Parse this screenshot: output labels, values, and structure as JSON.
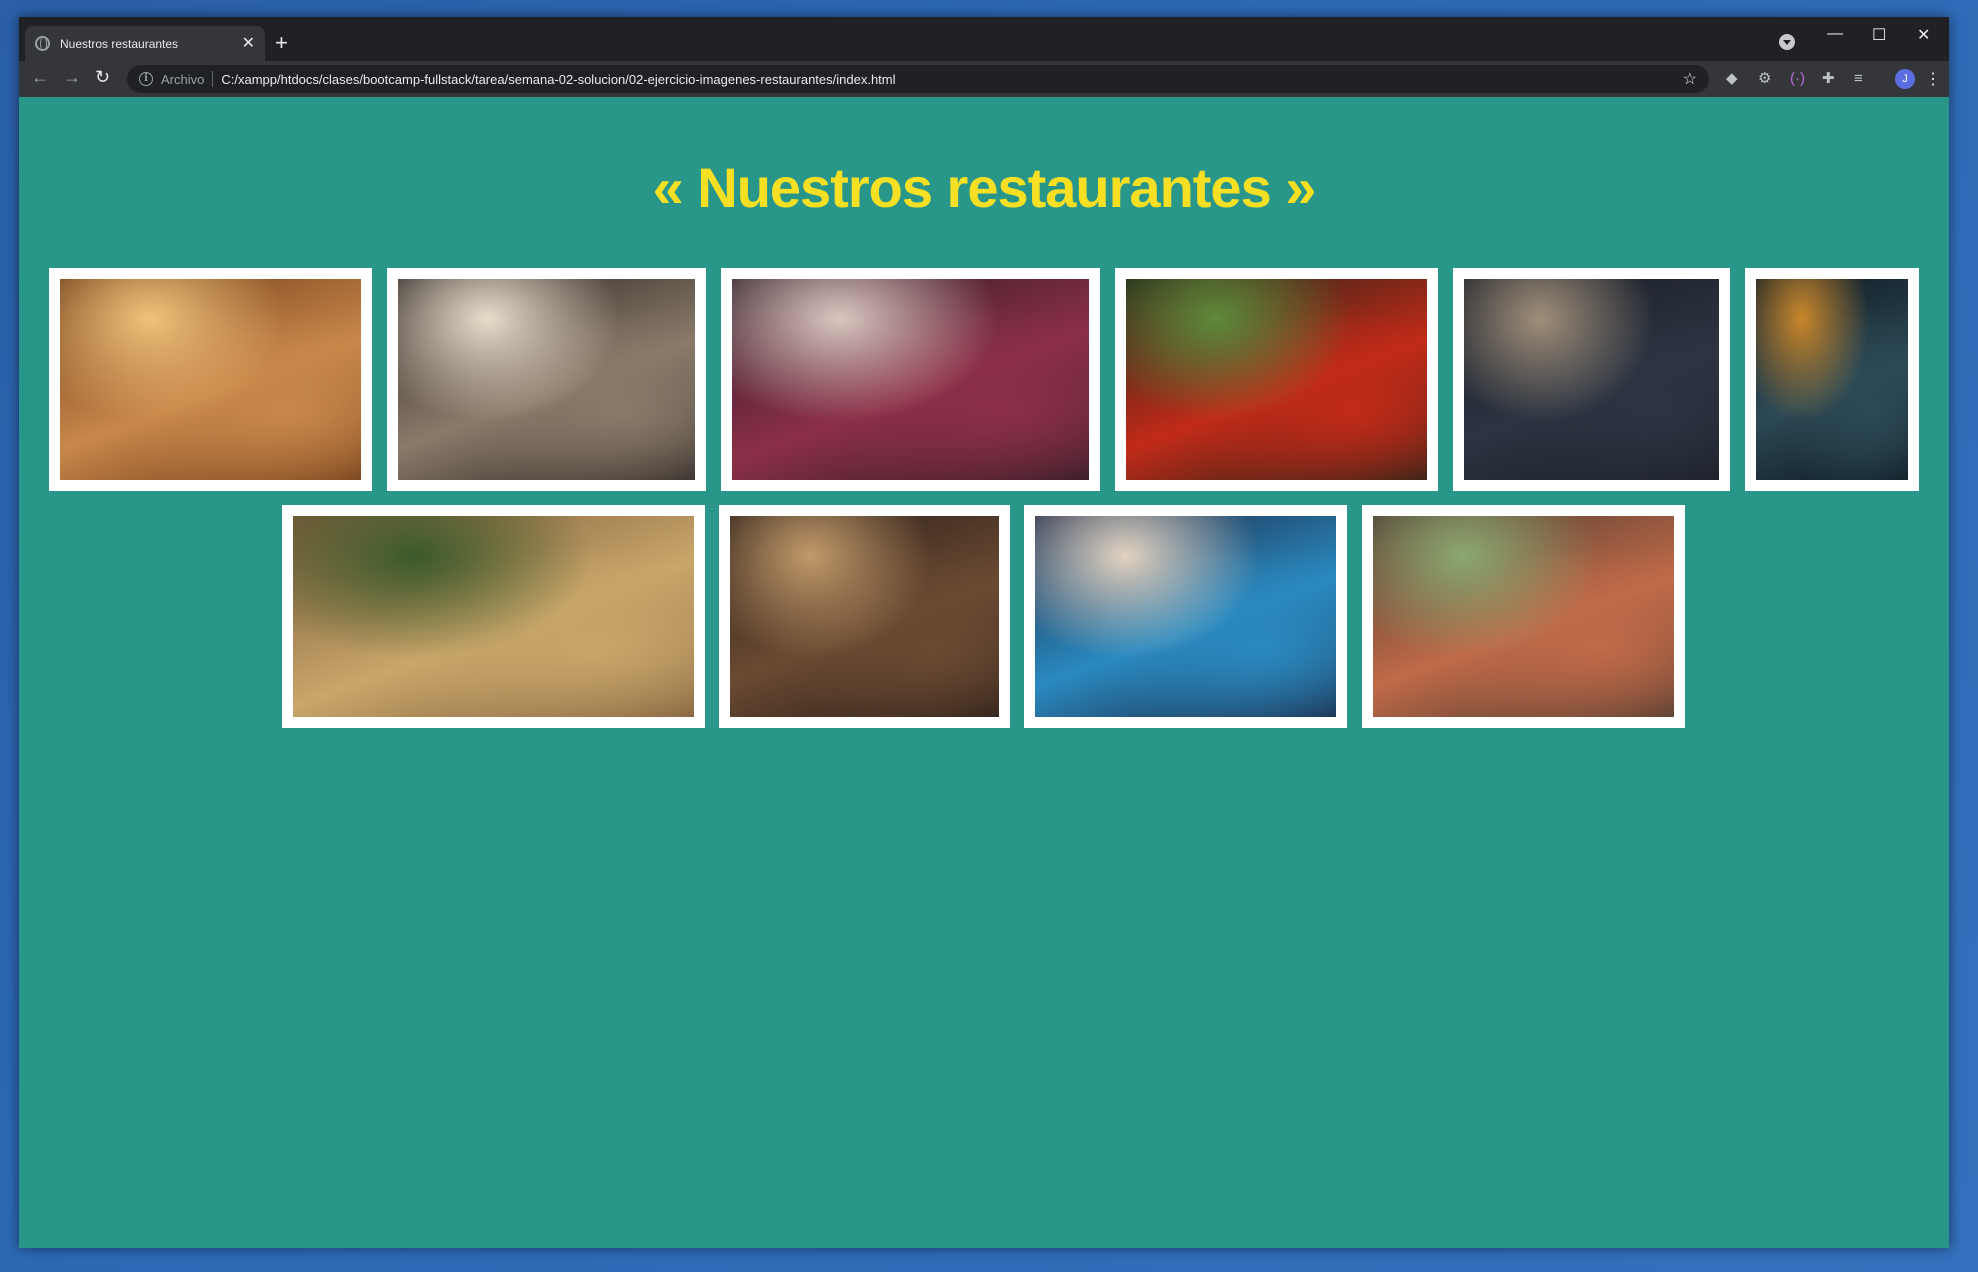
{
  "browser": {
    "tab_title": "Nuestros restaurantes",
    "tab_close": "✕",
    "new_tab": "+",
    "secure_label": "Archivo",
    "url": "C:/xampp/htdocs/clases/bootcamp-fullstack/tarea/semana-02-solucion/02-ejercicio-imagenes-restaurantes/index.html",
    "avatar_letter": "J",
    "icons": {
      "back": "←",
      "forward": "→",
      "reload": "↻",
      "star": "☆",
      "menu": "⋮",
      "minimize": "—",
      "maximize": "☐",
      "close": "✕"
    }
  },
  "page": {
    "title": "« Nuestros restaurantes »",
    "background_color": "#289689",
    "title_color": "#f7e024"
  },
  "gallery": [
    {
      "name": "restaurant-photo-1",
      "palette": [
        "#6b3a17",
        "#c9874a",
        "#f0c27a"
      ]
    },
    {
      "name": "restaurant-photo-2",
      "palette": [
        "#2b2522",
        "#8a7a6a",
        "#e8dccb"
      ]
    },
    {
      "name": "restaurant-photo-3",
      "palette": [
        "#2a1c22",
        "#8c2f48",
        "#d9c6c0"
      ]
    },
    {
      "name": "restaurant-photo-4",
      "palette": [
        "#1e2418",
        "#c22a18",
        "#5c8a3a"
      ]
    },
    {
      "name": "restaurant-photo-5",
      "palette": [
        "#1a1d25",
        "#2c3442",
        "#a08f7a"
      ]
    },
    {
      "name": "restaurant-photo-6",
      "palette": [
        "#0f1a22",
        "#2c4a56",
        "#c9872c"
      ]
    },
    {
      "name": "restaurant-photo-7",
      "palette": [
        "#7a5a3a",
        "#c9a66a",
        "#3c5a2a"
      ]
    },
    {
      "name": "restaurant-photo-8",
      "palette": [
        "#2a1e18",
        "#6b4a32",
        "#c29a6a"
      ]
    },
    {
      "name": "restaurant-photo-9",
      "palette": [
        "#1c2440",
        "#2a8ac0",
        "#e2d2c0"
      ]
    },
    {
      "name": "restaurant-photo-10",
      "palette": [
        "#4a3a30",
        "#c06a48",
        "#8aa870"
      ]
    }
  ]
}
